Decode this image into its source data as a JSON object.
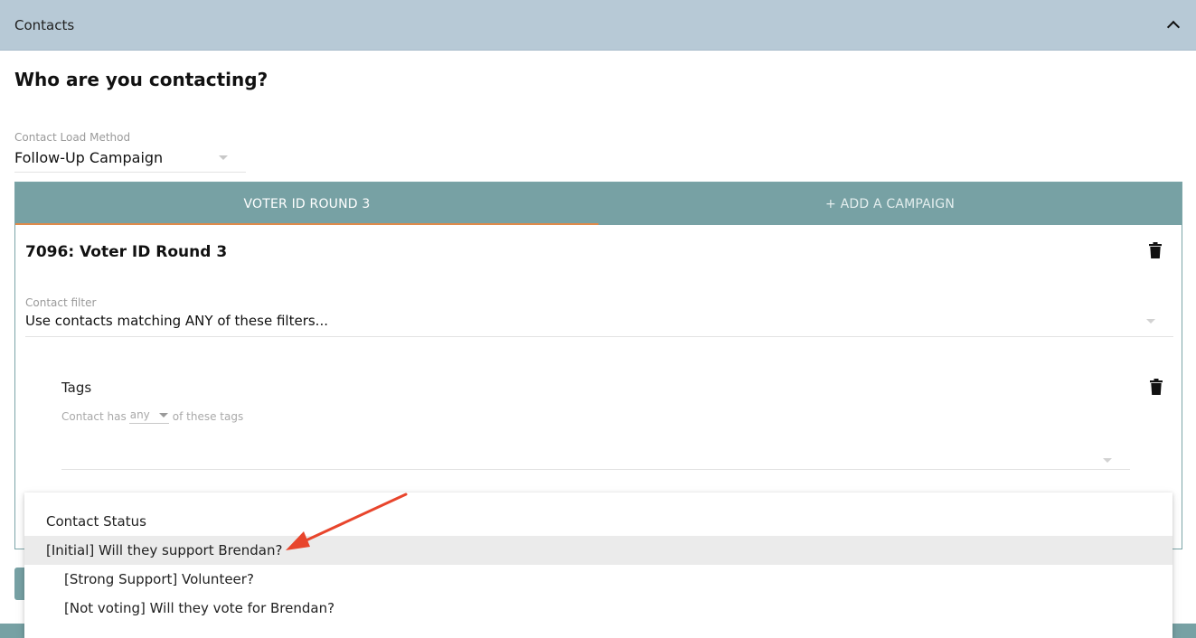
{
  "section": {
    "title": "Contacts",
    "collapse_icon": "chevron-up-icon"
  },
  "page_title": "Who are you contacting?",
  "load_method": {
    "label": "Contact Load Method",
    "value": "Follow-Up Campaign"
  },
  "tabs": [
    {
      "label": "VOTER ID ROUND 3",
      "active": true
    },
    {
      "label": "+ ADD A CAMPAIGN",
      "active": false
    }
  ],
  "campaign": {
    "name": "7096: Voter ID Round 3",
    "delete_icon": "trash-icon"
  },
  "contact_filter": {
    "label": "Contact filter",
    "value": "Use contacts matching ANY of these filters..."
  },
  "tags_filter": {
    "title": "Tags",
    "prefix": "Contact has",
    "mode": "any",
    "suffix": "of these tags",
    "delete_icon": "trash-icon"
  },
  "dropdown": {
    "header": "Contact Status",
    "items": [
      {
        "label": "[Initial] Will they support Brendan?",
        "selected": true
      },
      {
        "label": "[Strong Support] Volunteer?",
        "selected": false
      },
      {
        "label": "[Not voting] Will they vote for Brendan?",
        "selected": false
      }
    ]
  },
  "colors": {
    "header_bg": "#b7c9d6",
    "tab_bg": "#77a1a4",
    "tab_indicator": "#e08a4a",
    "selected_item_bg": "#ebebeb",
    "annotation_arrow": "#e8452c"
  }
}
